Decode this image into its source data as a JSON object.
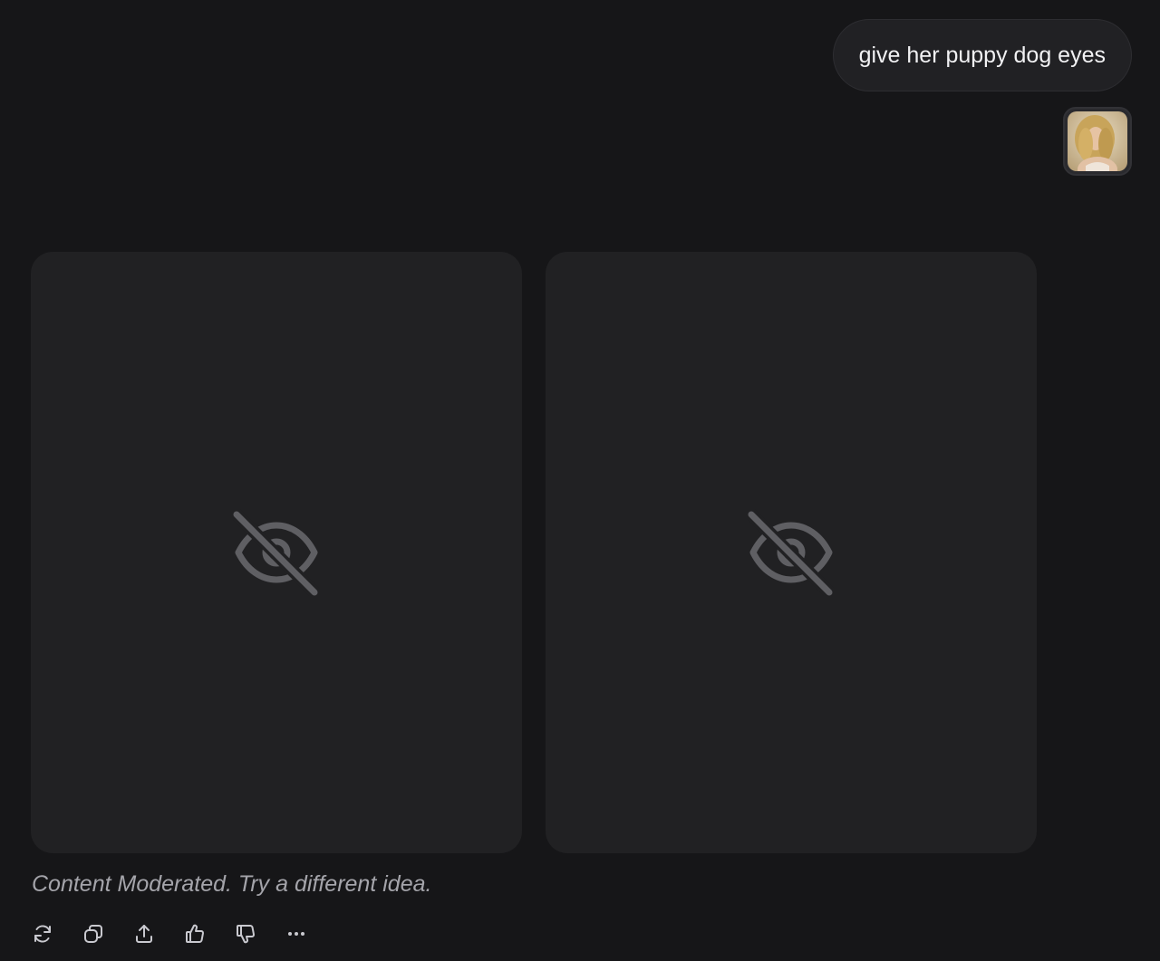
{
  "user_message": {
    "text": "give her puppy dog eyes"
  },
  "attachment": {
    "icon": "photo-thumbnail"
  },
  "results": [
    {
      "icon": "eye-off-icon",
      "state": "moderated"
    },
    {
      "icon": "eye-off-icon",
      "state": "moderated"
    }
  ],
  "moderation": {
    "text": "Content Moderated. Try a different idea."
  },
  "actions": [
    {
      "icon": "regenerate-icon"
    },
    {
      "icon": "copy-icon"
    },
    {
      "icon": "share-icon"
    },
    {
      "icon": "thumbs-up-icon"
    },
    {
      "icon": "thumbs-down-icon"
    },
    {
      "icon": "more-icon"
    }
  ],
  "colors": {
    "background": "#161618",
    "card": "#212123",
    "bubble": "#212124",
    "muted_text": "#a4a4aa",
    "icon": "#5f5f63",
    "action_icon": "#c9c9cf"
  }
}
